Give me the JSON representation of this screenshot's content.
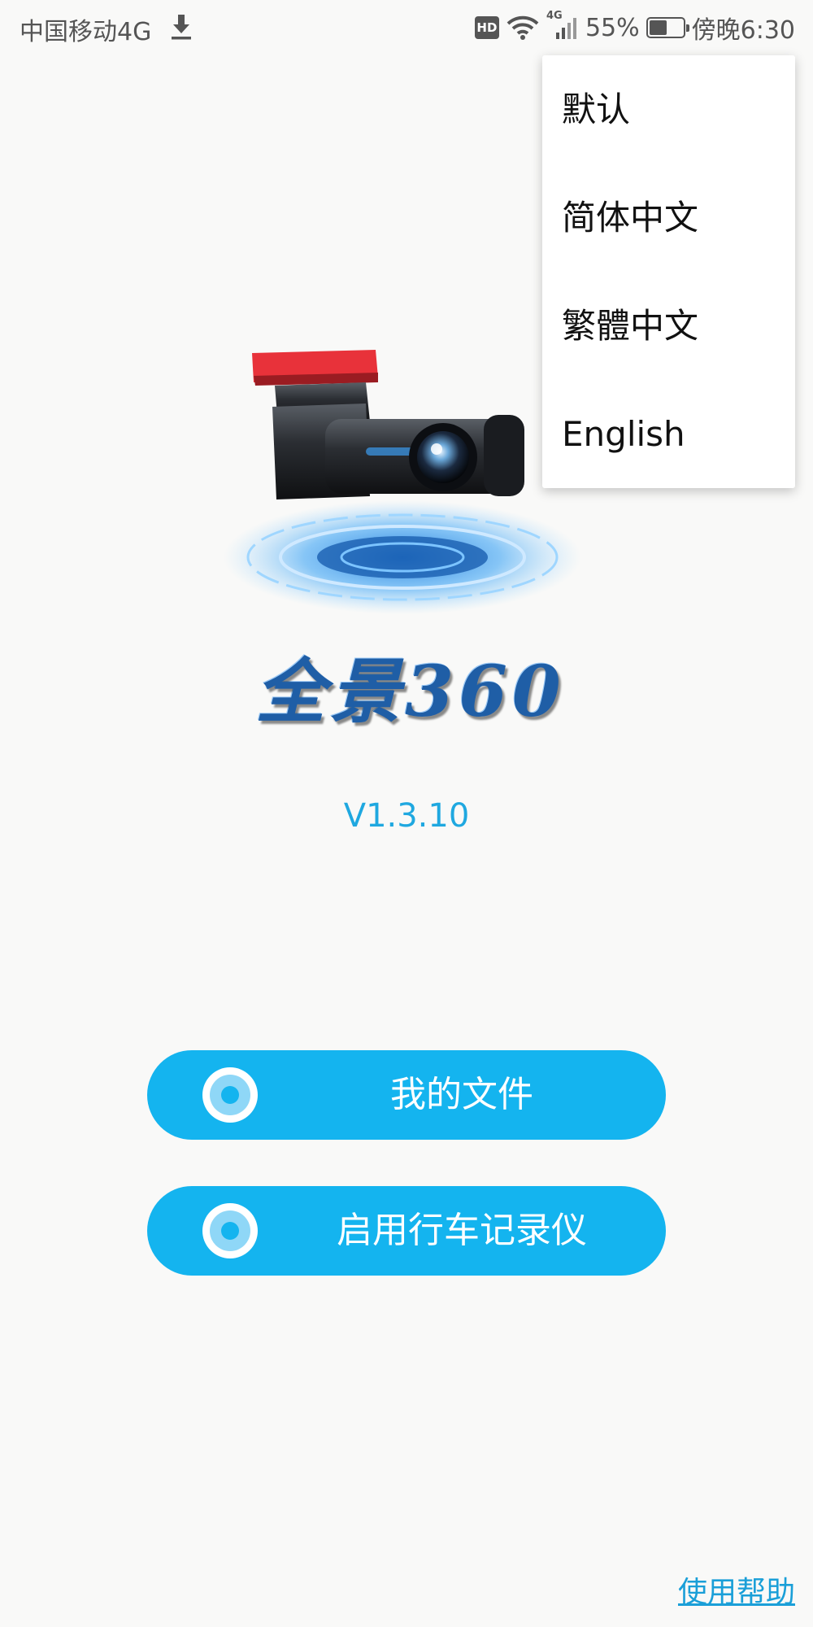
{
  "status_bar": {
    "carrier": "中国移动4G",
    "signal_label": "4G",
    "battery": "55%",
    "battery_level": 0.55,
    "time": "傍晚6:30",
    "hd_label": "HD"
  },
  "app": {
    "brand_text": "全景360",
    "version": "V1.3.10",
    "accent_color": "#14b4ef"
  },
  "buttons": {
    "my_files": "我的文件",
    "start_recorder": "启用行车记录仪"
  },
  "help_link": "使用帮助",
  "language_menu": {
    "items": [
      "默认",
      "简体中文",
      "繁體中文",
      "English"
    ]
  }
}
